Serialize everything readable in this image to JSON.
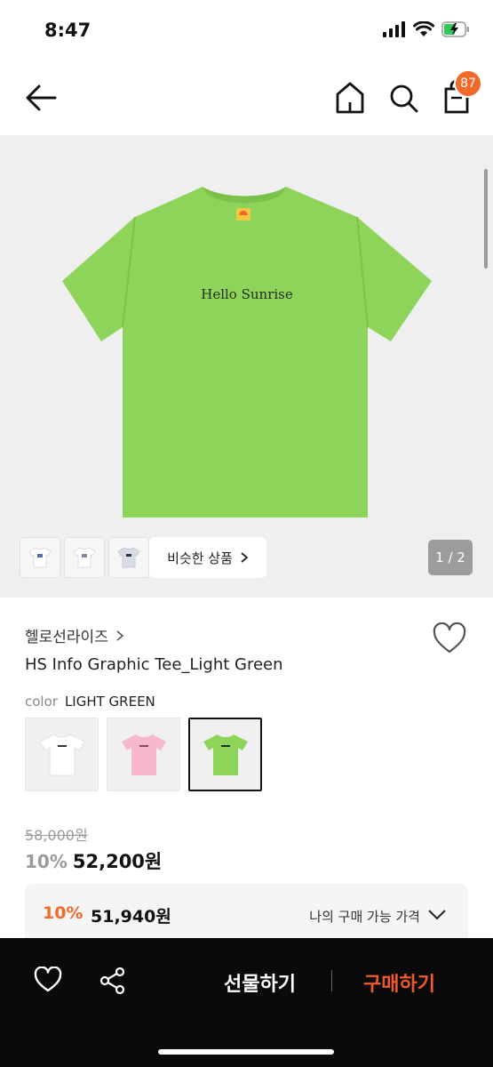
{
  "status_bar": {
    "time": "8:47",
    "icons": [
      "signal-icon",
      "wifi-icon",
      "battery-charging-icon"
    ]
  },
  "nav": {
    "icons": [
      "back-arrow-icon",
      "home-icon",
      "search-icon",
      "cart-icon"
    ],
    "cart_count": "87"
  },
  "gallery": {
    "shirt_text": "Hello Sunrise",
    "thumbnails": [
      "white-tee",
      "white-tee-back",
      "gray-tee"
    ],
    "similar_label": "비슷한 상품",
    "page": "1 / 2"
  },
  "product": {
    "brand": "헬로선라이즈",
    "title": "HS Info Graphic Tee_Light Green",
    "color_label": "color",
    "color_value": "LIGHT GREEN",
    "swatches": [
      "white",
      "pink",
      "light-green"
    ],
    "selected_swatch": "light-green",
    "original_price": "58,000원",
    "discount": "10%",
    "price": "52,200원",
    "my_price": {
      "discount": "10%",
      "price": "51,940원",
      "label": "나의 구매 가능 가격"
    }
  },
  "bottom_bar": {
    "gift_label": "선물하기",
    "buy_label": "구매하기"
  },
  "colors": {
    "accent": "#f26a2a",
    "shirt_green": "#8fd45a",
    "pink": "#f5b8cc",
    "bottom_bar": "#0a0a0a"
  }
}
